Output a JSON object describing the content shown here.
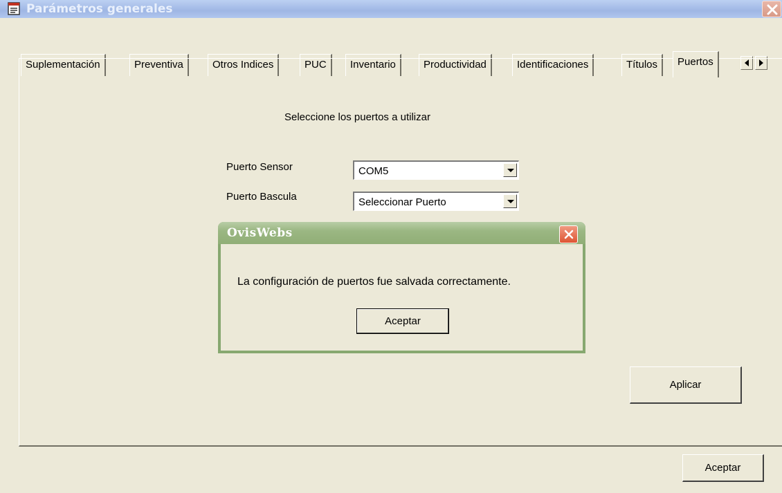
{
  "window": {
    "title": "Parámetros generales",
    "icon": "notepad-app-icon",
    "close_icon": "close-icon"
  },
  "tabs": [
    {
      "label": "Suplementación",
      "active": false
    },
    {
      "label": "Preventiva",
      "active": false
    },
    {
      "label": "Otros Indices",
      "active": false
    },
    {
      "label": "PUC",
      "active": false
    },
    {
      "label": "Inventario",
      "active": false
    },
    {
      "label": "Productividad",
      "active": false
    },
    {
      "label": "Identificaciones",
      "active": false
    },
    {
      "label": "Títulos",
      "active": false
    },
    {
      "label": "Puertos",
      "active": true
    }
  ],
  "ports": {
    "heading": "Seleccione los puertos a utilizar",
    "sensor_label": "Puerto Sensor",
    "sensor_value": "COM5",
    "scale_label": "Puerto Bascula",
    "scale_value": "Seleccionar Puerto"
  },
  "apply_label": "Aplicar",
  "accept_label": "Aceptar",
  "dialog": {
    "title": "OvisWebs",
    "message": "La configuración de puertos fue salvada correctamente.",
    "ok_label": "Aceptar"
  },
  "colors": {
    "window_bg": "#ece9d8",
    "dialog_frame": "#87a870",
    "dialog_close": "#de5533"
  }
}
